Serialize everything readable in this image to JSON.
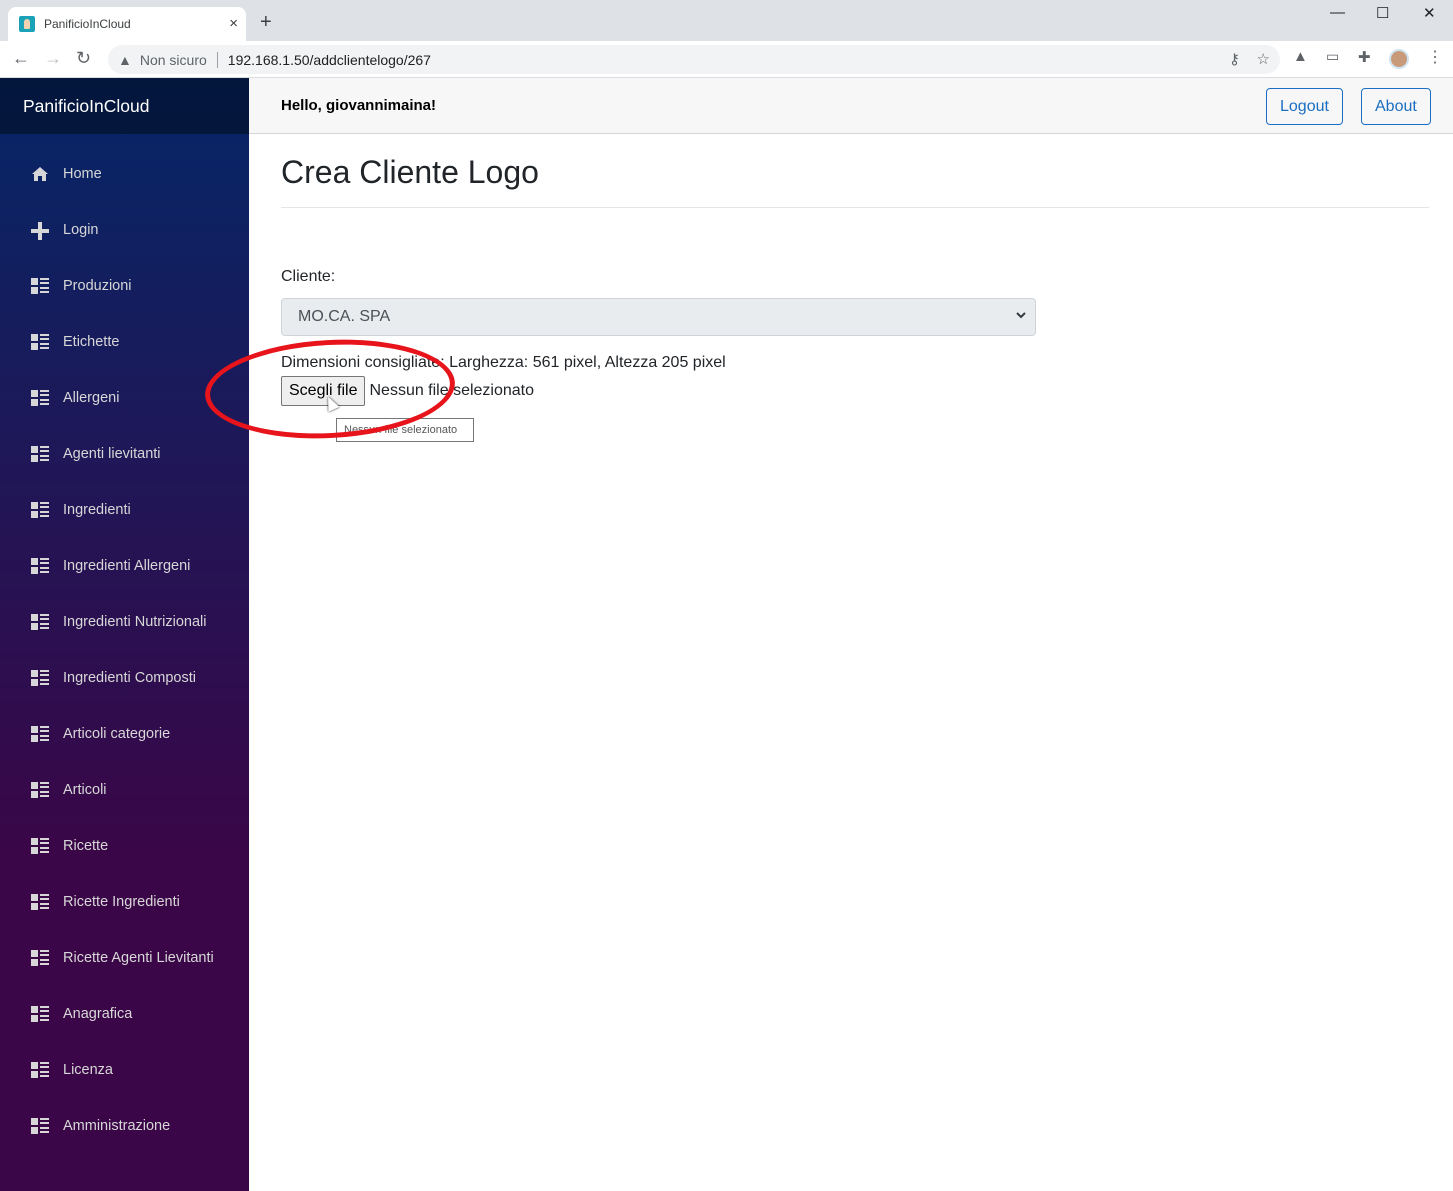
{
  "browser": {
    "tab_title": "PanificioInCloud",
    "tab_close": "×",
    "new_tab": "+",
    "security_label": "Non sicuro",
    "url": "192.168.1.50/addclientelogo/267",
    "icons": [
      "back-icon",
      "forward-icon",
      "reload-icon",
      "warning-icon",
      "key-icon",
      "star-icon",
      "drive-icon",
      "cast-icon",
      "extensions-icon",
      "profile-avatar",
      "menu-icon"
    ],
    "window_controls": {
      "minimize": "—",
      "maximize": "☐",
      "close": "✕"
    }
  },
  "sidebar": {
    "brand": "PanificioInCloud",
    "items": [
      {
        "label": "Home",
        "icon": "home-icon"
      },
      {
        "label": "Login",
        "icon": "plus-icon"
      },
      {
        "label": "Produzioni",
        "icon": "list-icon"
      },
      {
        "label": "Etichette",
        "icon": "list-icon"
      },
      {
        "label": "Allergeni",
        "icon": "list-icon"
      },
      {
        "label": "Agenti lievitanti",
        "icon": "list-icon"
      },
      {
        "label": "Ingredienti",
        "icon": "list-icon"
      },
      {
        "label": "Ingredienti Allergeni",
        "icon": "list-icon"
      },
      {
        "label": "Ingredienti Nutrizionali",
        "icon": "list-icon"
      },
      {
        "label": "Ingredienti Composti",
        "icon": "list-icon"
      },
      {
        "label": "Articoli categorie",
        "icon": "list-icon"
      },
      {
        "label": "Articoli",
        "icon": "list-icon"
      },
      {
        "label": "Ricette",
        "icon": "list-icon"
      },
      {
        "label": "Ricette Ingredienti",
        "icon": "list-icon"
      },
      {
        "label": "Ricette Agenti Lievitanti",
        "icon": "list-icon"
      },
      {
        "label": "Anagrafica",
        "icon": "list-icon"
      },
      {
        "label": "Licenza",
        "icon": "list-icon"
      },
      {
        "label": "Amministrazione",
        "icon": "list-icon"
      }
    ]
  },
  "topbar": {
    "greeting": "Hello, giovannimaina!",
    "logout_label": "Logout",
    "about_label": "About"
  },
  "page": {
    "title": "Crea Cliente Logo",
    "cliente_label": "Cliente:",
    "cliente_selected": "MO.CA. SPA",
    "dimensions_hint": "Dimensioni consigliate: Larghezza: 561 pixel, Altezza 205 pixel",
    "file_button_label": "Scegli file",
    "file_status": "Nessun file selezionato",
    "tooltip": "Nessun file selezionato"
  },
  "colors": {
    "accent": "#1b6ec2",
    "sidebar_top": "#052767",
    "sidebar_bottom": "#3a0647",
    "annotation": "#e8141b"
  }
}
